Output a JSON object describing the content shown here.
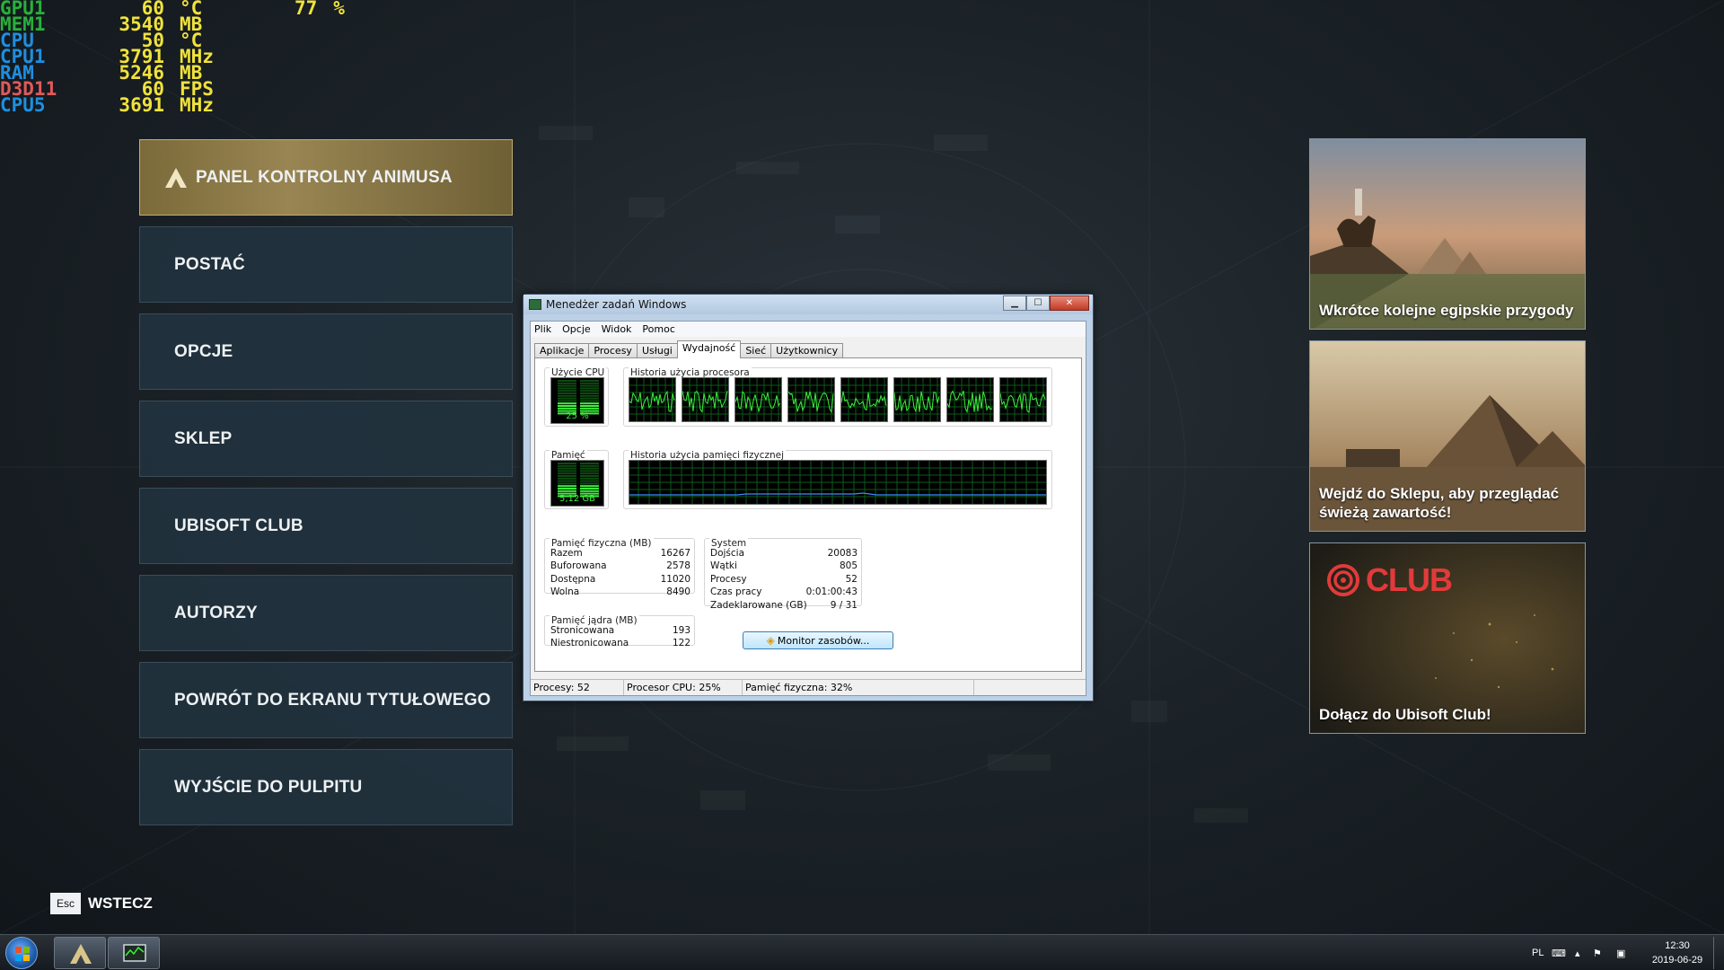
{
  "osd": {
    "rows": [
      {
        "key": "GPU1",
        "value": "60",
        "unit": "°C",
        "color": "#27b13a"
      },
      {
        "key": "MEM1",
        "value": "3540",
        "unit": "MB",
        "color": "#27b13a"
      },
      {
        "key": "CPU",
        "value": "50",
        "unit": "°C",
        "color": "#1e8fe0"
      },
      {
        "key": "CPU1",
        "value": "3791",
        "unit": "MHz",
        "color": "#1e8fe0"
      },
      {
        "key": "RAM",
        "value": "5246",
        "unit": "MB",
        "color": "#1e8fe0"
      },
      {
        "key": "D3D11",
        "value": "60",
        "unit": "FPS",
        "color": "#e05a5a"
      },
      {
        "key": "CPU5",
        "value": "3691",
        "unit": "MHz",
        "color": "#1e8fe0"
      }
    ],
    "extra_value": "77",
    "extra_unit": "%"
  },
  "menu": {
    "items": [
      {
        "label": "PANEL KONTROLNY ANIMUSA"
      },
      {
        "label": "POSTAĆ"
      },
      {
        "label": "OPCJE"
      },
      {
        "label": "SKLEP"
      },
      {
        "label": "UBISOFT CLUB"
      },
      {
        "label": "AUTORZY"
      },
      {
        "label": "POWRÓT DO EKRANU TYTUŁOWEGO"
      },
      {
        "label": "WYJŚCIE DO PULPITU"
      }
    ],
    "active_index": 0
  },
  "back": {
    "key": "Esc",
    "label": "WSTECZ"
  },
  "cards": [
    {
      "caption": "Wkrótce kolejne egipskie przygody"
    },
    {
      "caption": "Wejdź do Sklepu, aby przeglądać świeżą zawartość!"
    },
    {
      "caption": "Dołącz do Ubisoft Club!",
      "logo_text": "CLUB"
    }
  ],
  "taskmgr": {
    "title": "Menedżer zadań Windows",
    "menus": [
      "Plik",
      "Opcje",
      "Widok",
      "Pomoc"
    ],
    "tabs": [
      "Aplikacje",
      "Procesy",
      "Usługi",
      "Wydajność",
      "Sieć",
      "Użytkownicy"
    ],
    "selected_tab": 3,
    "cpu_usage_label": "Użycie CPU",
    "cpu_usage_value": "25 %",
    "cpu_history_label": "Historia użycia procesora",
    "mem_label": "Pamięć",
    "mem_value": "5,12 GB",
    "mem_history_label": "Historia użycia pamięci fizycznej",
    "physical": {
      "label": "Pamięć fizyczna (MB)",
      "rows": [
        [
          "Razem",
          "16267"
        ],
        [
          "Buforowana",
          "2578"
        ],
        [
          "Dostępna",
          "11020"
        ],
        [
          "Wolna",
          "8490"
        ]
      ]
    },
    "kernel": {
      "label": "Pamięć jądra (MB)",
      "rows": [
        [
          "Stronicowana",
          "193"
        ],
        [
          "Niestronicowana",
          "122"
        ]
      ]
    },
    "system": {
      "label": "System",
      "rows": [
        [
          "Dojścia",
          "20083"
        ],
        [
          "Wątki",
          "805"
        ],
        [
          "Procesy",
          "52"
        ],
        [
          "Czas pracy",
          "0:01:00:43"
        ],
        [
          "Zadeklarowane (GB)",
          "9 / 31"
        ]
      ]
    },
    "monitor_button": "Monitor zasobów...",
    "status": [
      "Procesy: 52",
      "Procesor CPU: 25%",
      "Pamięć fizyczna: 32%"
    ],
    "cpu_percent": 25,
    "mem_percent": 32
  },
  "taskbar": {
    "lang": "PL",
    "time": "12:30",
    "date": "2019-06-29"
  }
}
